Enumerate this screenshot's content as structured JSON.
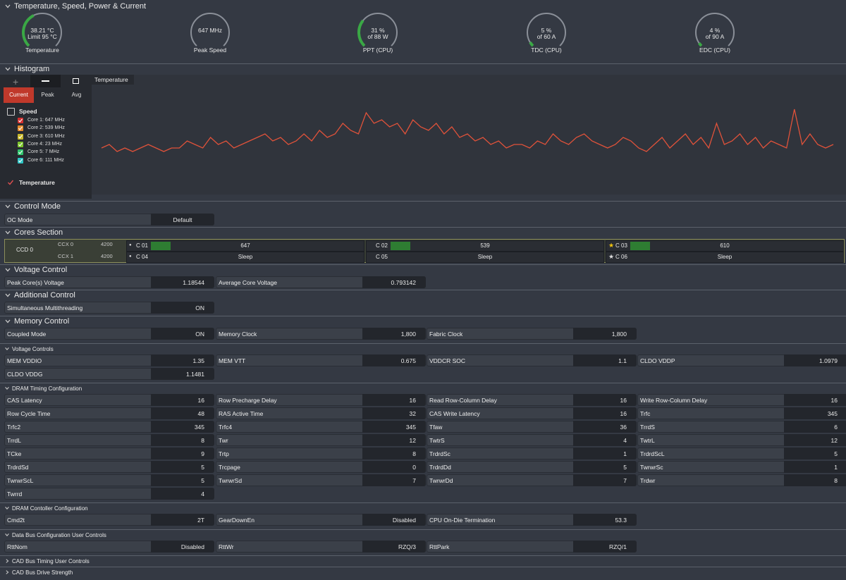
{
  "sections": {
    "temp": "Temperature, Speed, Power & Current",
    "histogram": "Histogram",
    "control_mode": "Control Mode",
    "cores": "Cores Section",
    "voltage": "Voltage Control",
    "additional": "Additional Control",
    "memory": "Memory Control",
    "voltage_controls": "Voltage Controls",
    "dram_timing": "DRAM Timing Configuration",
    "dram_controller": "DRAM Contoller Configuration",
    "data_bus": "Data Bus Configuration User Controls",
    "cad_timing": "CAD Bus Timing User Controls",
    "cad_drive": "CAD Bus Drive Strength"
  },
  "gauges": [
    {
      "line1": "38.21 °C",
      "line2": "Limit 95 °C",
      "caption": "Temperature",
      "level": 0.4
    },
    {
      "line1": "647  MHz",
      "line2": "",
      "caption": "Peak Speed",
      "level": 0.0
    },
    {
      "line1": "31 %",
      "line2": "of 88 W",
      "caption": "PPT (CPU)",
      "level": 0.31
    },
    {
      "line1": "5 %",
      "line2": "of 60 A",
      "caption": "TDC (CPU)",
      "level": 0.05
    },
    {
      "line1": "4 %",
      "line2": "of 90 A",
      "caption": "EDC (CPU)",
      "level": 0.04
    }
  ],
  "histogram": {
    "tabs": [
      "Current",
      "Peak",
      "Avg"
    ],
    "chart_title": "Temperature",
    "speed_label": "Speed",
    "cores": [
      "Core 1: 647 MHz",
      "Core 2: 539 MHz",
      "Core 3: 610 MHz",
      "Core 4: 23 MHz",
      "Core 5: 7 MHz",
      "Core 6: 111 MHz"
    ],
    "core_colors": [
      "#d32f2f",
      "#e58a2c",
      "#c8b82a",
      "#7cc42b",
      "#2fc46c",
      "#2fc4c4"
    ],
    "temp_label": "Temperature",
    "line_color": "#e0523a"
  },
  "control_mode": {
    "label": "OC Mode",
    "value": "Default"
  },
  "cores": {
    "ccd": "CCD 0",
    "ccx": [
      {
        "name": "CCX 0",
        "freq": "4200"
      },
      {
        "name": "CCX 1",
        "freq": "4200"
      }
    ],
    "cells": [
      {
        "name": "C 01",
        "value": "647"
      },
      {
        "name": "C 02",
        "value": "539"
      },
      {
        "name": "C 03",
        "value": "610"
      },
      {
        "name": "C 04",
        "value": "Sleep"
      },
      {
        "name": "C 05",
        "value": "Sleep"
      },
      {
        "name": "C 06",
        "value": "Sleep"
      }
    ]
  },
  "voltage": [
    {
      "label": "Peak Core(s) Voltage",
      "value": "1.18544"
    },
    {
      "label": "Average Core Voltage",
      "value": "0.793142"
    }
  ],
  "additional": [
    {
      "label": "Simultaneous Multithreading",
      "value": "ON"
    }
  ],
  "memory": [
    {
      "label": "Coupled Mode",
      "value": "ON"
    },
    {
      "label": "Memory Clock",
      "value": "1,800"
    },
    {
      "label": "Fabric Clock",
      "value": "1,800"
    }
  ],
  "voltage_controls": [
    {
      "label": "MEM VDDIO",
      "value": "1.35"
    },
    {
      "label": "MEM VTT",
      "value": "0.675"
    },
    {
      "label": "VDDCR SOC",
      "value": "1.1"
    },
    {
      "label": "CLDO VDDP",
      "value": "1.0979"
    },
    {
      "label": "CLDO VDDG",
      "value": "1.1481"
    }
  ],
  "dram_timing": [
    {
      "label": "CAS Latency",
      "value": "16"
    },
    {
      "label": "Row Precharge Delay",
      "value": "16"
    },
    {
      "label": "Read Row-Column Delay",
      "value": "16"
    },
    {
      "label": "Write Row-Column Delay",
      "value": "16"
    },
    {
      "label": "Row Cycle Time",
      "value": "48"
    },
    {
      "label": "RAS Active Time",
      "value": "32"
    },
    {
      "label": "CAS Write Latency",
      "value": "16"
    },
    {
      "label": "Trfc",
      "value": "345"
    },
    {
      "label": "Trfc2",
      "value": "345"
    },
    {
      "label": "Trfc4",
      "value": "345"
    },
    {
      "label": "Tfaw",
      "value": "36"
    },
    {
      "label": "TrrdS",
      "value": "6"
    },
    {
      "label": "TrrdL",
      "value": "8"
    },
    {
      "label": "Twr",
      "value": "12"
    },
    {
      "label": "TwtrS",
      "value": "4"
    },
    {
      "label": "TwtrL",
      "value": "12"
    },
    {
      "label": "TCke",
      "value": "9"
    },
    {
      "label": "Trtp",
      "value": "8"
    },
    {
      "label": "TrdrdSc",
      "value": "1"
    },
    {
      "label": "TrdrdScL",
      "value": "5"
    },
    {
      "label": "TrdrdSd",
      "value": "5"
    },
    {
      "label": "Trcpage",
      "value": "0"
    },
    {
      "label": "TrdrdDd",
      "value": "5"
    },
    {
      "label": "TwrwrSc",
      "value": "1"
    },
    {
      "label": "TwrwrScL",
      "value": "5"
    },
    {
      "label": "TwrwrSd",
      "value": "7"
    },
    {
      "label": "TwrwrDd",
      "value": "7"
    },
    {
      "label": "Trdwr",
      "value": "8"
    },
    {
      "label": "Twrrd",
      "value": "4"
    }
  ],
  "dram_controller": [
    {
      "label": "Cmd2t",
      "value": "2T"
    },
    {
      "label": "GearDownEn",
      "value": "Disabled"
    },
    {
      "label": "CPU On-Die Termination",
      "value": "53.3"
    }
  ],
  "data_bus": [
    {
      "label": "RttNom",
      "value": "Disabled"
    },
    {
      "label": "RttWr",
      "value": "RZQ/3"
    },
    {
      "label": "RttPark",
      "value": "RZQ/1"
    }
  ],
  "chart_data": {
    "type": "line",
    "title": "Temperature",
    "series": [
      {
        "name": "Temperature",
        "values": [
          38.2,
          38.3,
          38.1,
          38.2,
          38.1,
          38.2,
          38.3,
          38.2,
          38.1,
          38.2,
          38.2,
          38.4,
          38.3,
          38.2,
          38.5,
          38.3,
          38.4,
          38.2,
          38.3,
          38.4,
          38.5,
          38.6,
          38.4,
          38.5,
          38.3,
          38.4,
          38.6,
          38.4,
          38.7,
          38.5,
          38.6,
          38.9,
          38.7,
          38.6,
          39.2,
          38.9,
          39.0,
          38.8,
          38.9,
          38.6,
          39.0,
          38.8,
          38.7,
          38.9,
          38.6,
          38.8,
          38.5,
          38.6,
          38.4,
          38.5,
          38.3,
          38.4,
          38.2,
          38.3,
          38.3,
          38.2,
          38.4,
          38.3,
          38.6,
          38.4,
          38.3,
          38.5,
          38.6,
          38.4,
          38.3,
          38.2,
          38.3,
          38.5,
          38.4,
          38.2,
          38.1,
          38.3,
          38.5,
          38.2,
          38.4,
          38.6,
          38.3,
          38.5,
          38.2,
          38.9,
          38.3,
          38.4,
          38.6,
          38.3,
          38.5,
          38.2,
          38.4,
          38.3,
          38.2,
          39.3,
          38.3,
          38.6,
          38.3,
          38.2,
          38.3
        ]
      }
    ]
  }
}
